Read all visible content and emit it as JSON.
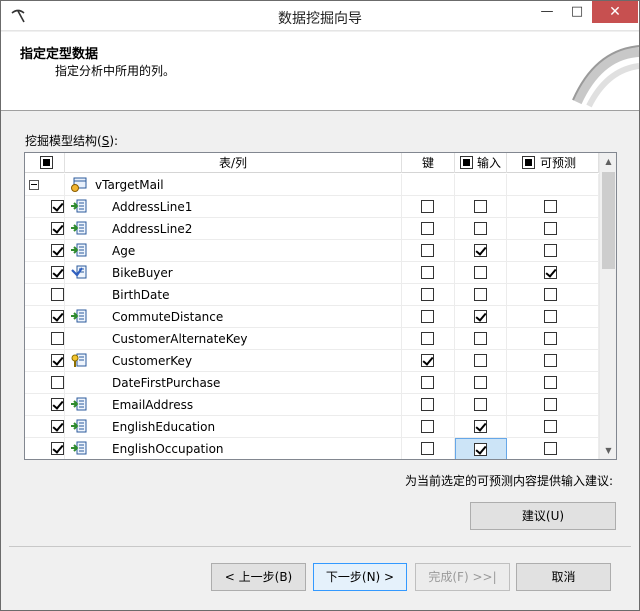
{
  "window": {
    "title": "数据挖掘向导",
    "min_symbol": "▫",
    "max_symbol": "□",
    "close_symbol": "✕"
  },
  "header": {
    "title": "指定定型数据",
    "subtitle": "指定分析中所用的列。"
  },
  "structure_label_prefix": "挖掘模型结构(",
  "structure_label_key": "S",
  "structure_label_suffix": "):",
  "grid": {
    "columns": {
      "name": "表/列",
      "key": "键",
      "input": "输入",
      "predict": "可预测"
    },
    "table": {
      "name": "vTargetMail",
      "expanded": true
    },
    "rows": [
      {
        "name": "AddressLine1",
        "selected": true,
        "icon": "column-input-icon",
        "key": false,
        "input": false,
        "predict": false
      },
      {
        "name": "AddressLine2",
        "selected": true,
        "icon": "column-input-icon",
        "key": false,
        "input": false,
        "predict": false
      },
      {
        "name": "Age",
        "selected": true,
        "icon": "column-input-icon",
        "key": false,
        "input": true,
        "predict": false
      },
      {
        "name": "BikeBuyer",
        "selected": true,
        "icon": "column-predict-icon",
        "key": false,
        "input": false,
        "predict": true
      },
      {
        "name": "BirthDate",
        "selected": false,
        "icon": "",
        "key": false,
        "input": false,
        "predict": false
      },
      {
        "name": "CommuteDistance",
        "selected": true,
        "icon": "column-input-icon",
        "key": false,
        "input": true,
        "predict": false
      },
      {
        "name": "CustomerAlternateKey",
        "selected": false,
        "icon": "",
        "key": false,
        "input": false,
        "predict": false
      },
      {
        "name": "CustomerKey",
        "selected": true,
        "icon": "column-key-icon",
        "key": true,
        "input": false,
        "predict": false
      },
      {
        "name": "DateFirstPurchase",
        "selected": false,
        "icon": "",
        "key": false,
        "input": false,
        "predict": false
      },
      {
        "name": "EmailAddress",
        "selected": true,
        "icon": "column-input-icon",
        "key": false,
        "input": false,
        "predict": false
      },
      {
        "name": "EnglishEducation",
        "selected": true,
        "icon": "column-input-icon",
        "key": false,
        "input": true,
        "predict": false
      },
      {
        "name": "EnglishOccupation",
        "selected": true,
        "icon": "column-input-icon",
        "key": false,
        "input": true,
        "predict": false,
        "focused_cell": "input"
      }
    ]
  },
  "suggest_text": "为当前选定的可预测内容提供输入建议:",
  "buttons": {
    "suggest": "建议(U)",
    "back": "< 上一步(B)",
    "next": "下一步(N) >",
    "finish": "完成(F) >>|",
    "cancel": "取消"
  },
  "colors": {
    "close_button": "#c75050",
    "selection_highlight": "#cce4f7",
    "primary_button_border": "#3399ff"
  }
}
